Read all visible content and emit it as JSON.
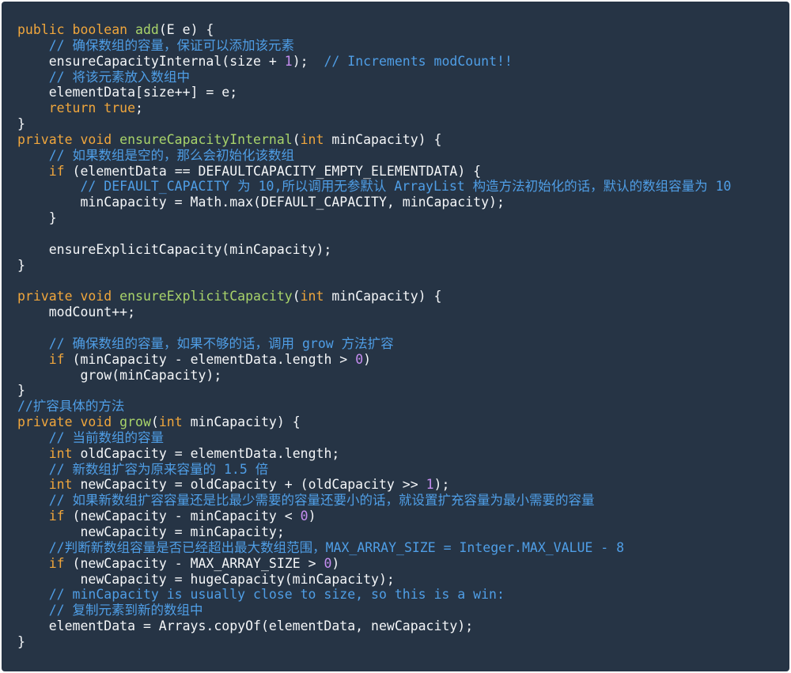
{
  "colors": {
    "background": "#263445",
    "text": "#f4f6f8",
    "keyword": "#f0a63c",
    "function": "#a8d36a",
    "number": "#c58df0",
    "comment": "#4f9ee6"
  },
  "code": {
    "lines": [
      [
        {
          "t": "public boolean ",
          "c": "kw"
        },
        {
          "t": "add",
          "c": "fn"
        },
        {
          "t": "(E e) {",
          "c": ""
        }
      ],
      [
        {
          "t": "    // 确保数组的容量，保证可以添加该元素",
          "c": "cm"
        }
      ],
      [
        {
          "t": "    ensureCapacityInternal(size + ",
          "c": ""
        },
        {
          "t": "1",
          "c": "num"
        },
        {
          "t": ");  ",
          "c": ""
        },
        {
          "t": "// Increments modCount!!",
          "c": "cm"
        }
      ],
      [
        {
          "t": "    // 将该元素放入数组中",
          "c": "cm"
        }
      ],
      [
        {
          "t": "    elementData[size++] = e;",
          "c": ""
        }
      ],
      [
        {
          "t": "    ",
          "c": ""
        },
        {
          "t": "return true",
          "c": "kw"
        },
        {
          "t": ";",
          "c": ""
        }
      ],
      [
        {
          "t": "}",
          "c": ""
        }
      ],
      [
        {
          "t": "private void ",
          "c": "kw"
        },
        {
          "t": "ensureCapacityInternal",
          "c": "fn"
        },
        {
          "t": "(",
          "c": ""
        },
        {
          "t": "int",
          "c": "kw"
        },
        {
          "t": " minCapacity) {",
          "c": ""
        }
      ],
      [
        {
          "t": "    // 如果数组是空的，那么会初始化该数组",
          "c": "cm"
        }
      ],
      [
        {
          "t": "    ",
          "c": ""
        },
        {
          "t": "if",
          "c": "kw"
        },
        {
          "t": " (elementData == DEFAULTCAPACITY_EMPTY_ELEMENTDATA) {",
          "c": ""
        }
      ],
      [
        {
          "t": "        // DEFAULT_CAPACITY 为 10,所以调用无参默认 ArrayList 构造方法初始化的话，默认的数组容量为 10",
          "c": "cm"
        }
      ],
      [
        {
          "t": "        minCapacity = Math.max(DEFAULT_CAPACITY, minCapacity);",
          "c": ""
        }
      ],
      [
        {
          "t": "    }",
          "c": ""
        }
      ],
      [
        {
          "t": "",
          "c": ""
        }
      ],
      [
        {
          "t": "    ensureExplicitCapacity(minCapacity);",
          "c": ""
        }
      ],
      [
        {
          "t": "}",
          "c": ""
        }
      ],
      [
        {
          "t": "",
          "c": ""
        }
      ],
      [
        {
          "t": "private void ",
          "c": "kw"
        },
        {
          "t": "ensureExplicitCapacity",
          "c": "fn"
        },
        {
          "t": "(",
          "c": ""
        },
        {
          "t": "int",
          "c": "kw"
        },
        {
          "t": " minCapacity) {",
          "c": ""
        }
      ],
      [
        {
          "t": "    modCount++;",
          "c": ""
        }
      ],
      [
        {
          "t": "",
          "c": ""
        }
      ],
      [
        {
          "t": "    // 确保数组的容量，如果不够的话，调用 grow 方法扩容",
          "c": "cm"
        }
      ],
      [
        {
          "t": "    ",
          "c": ""
        },
        {
          "t": "if",
          "c": "kw"
        },
        {
          "t": " (minCapacity - elementData.length > ",
          "c": ""
        },
        {
          "t": "0",
          "c": "num"
        },
        {
          "t": ")",
          "c": ""
        }
      ],
      [
        {
          "t": "        grow(minCapacity);",
          "c": ""
        }
      ],
      [
        {
          "t": "}",
          "c": ""
        }
      ],
      [
        {
          "t": "//扩容具体的方法",
          "c": "cm"
        }
      ],
      [
        {
          "t": "private void ",
          "c": "kw"
        },
        {
          "t": "grow",
          "c": "fn"
        },
        {
          "t": "(",
          "c": ""
        },
        {
          "t": "int",
          "c": "kw"
        },
        {
          "t": " minCapacity) {",
          "c": ""
        }
      ],
      [
        {
          "t": "    // 当前数组的容量",
          "c": "cm"
        }
      ],
      [
        {
          "t": "    ",
          "c": ""
        },
        {
          "t": "int",
          "c": "kw"
        },
        {
          "t": " oldCapacity = elementData.length;",
          "c": ""
        }
      ],
      [
        {
          "t": "    // 新数组扩容为原来容量的 1.5 倍",
          "c": "cm"
        }
      ],
      [
        {
          "t": "    ",
          "c": ""
        },
        {
          "t": "int",
          "c": "kw"
        },
        {
          "t": " newCapacity = oldCapacity + (oldCapacity >> ",
          "c": ""
        },
        {
          "t": "1",
          "c": "num"
        },
        {
          "t": ");",
          "c": ""
        }
      ],
      [
        {
          "t": "    // 如果新数组扩容容量还是比最少需要的容量还要小的话，就设置扩充容量为最小需要的容量",
          "c": "cm"
        }
      ],
      [
        {
          "t": "    ",
          "c": ""
        },
        {
          "t": "if",
          "c": "kw"
        },
        {
          "t": " (newCapacity - minCapacity < ",
          "c": ""
        },
        {
          "t": "0",
          "c": "num"
        },
        {
          "t": ")",
          "c": ""
        }
      ],
      [
        {
          "t": "        newCapacity = minCapacity;",
          "c": ""
        }
      ],
      [
        {
          "t": "    //判断新数组容量是否已经超出最大数组范围，MAX_ARRAY_SIZE = Integer.MAX_VALUE - 8",
          "c": "cm"
        }
      ],
      [
        {
          "t": "    ",
          "c": ""
        },
        {
          "t": "if",
          "c": "kw"
        },
        {
          "t": " (newCapacity - MAX_ARRAY_SIZE > ",
          "c": ""
        },
        {
          "t": "0",
          "c": "num"
        },
        {
          "t": ")",
          "c": ""
        }
      ],
      [
        {
          "t": "        newCapacity = hugeCapacity(minCapacity);",
          "c": ""
        }
      ],
      [
        {
          "t": "    // minCapacity is usually close to size, so this is a win:",
          "c": "cm"
        }
      ],
      [
        {
          "t": "    // 复制元素到新的数组中",
          "c": "cm"
        }
      ],
      [
        {
          "t": "    elementData = Arrays.copyOf(elementData, newCapacity);",
          "c": ""
        }
      ],
      [
        {
          "t": "}",
          "c": ""
        }
      ]
    ]
  }
}
